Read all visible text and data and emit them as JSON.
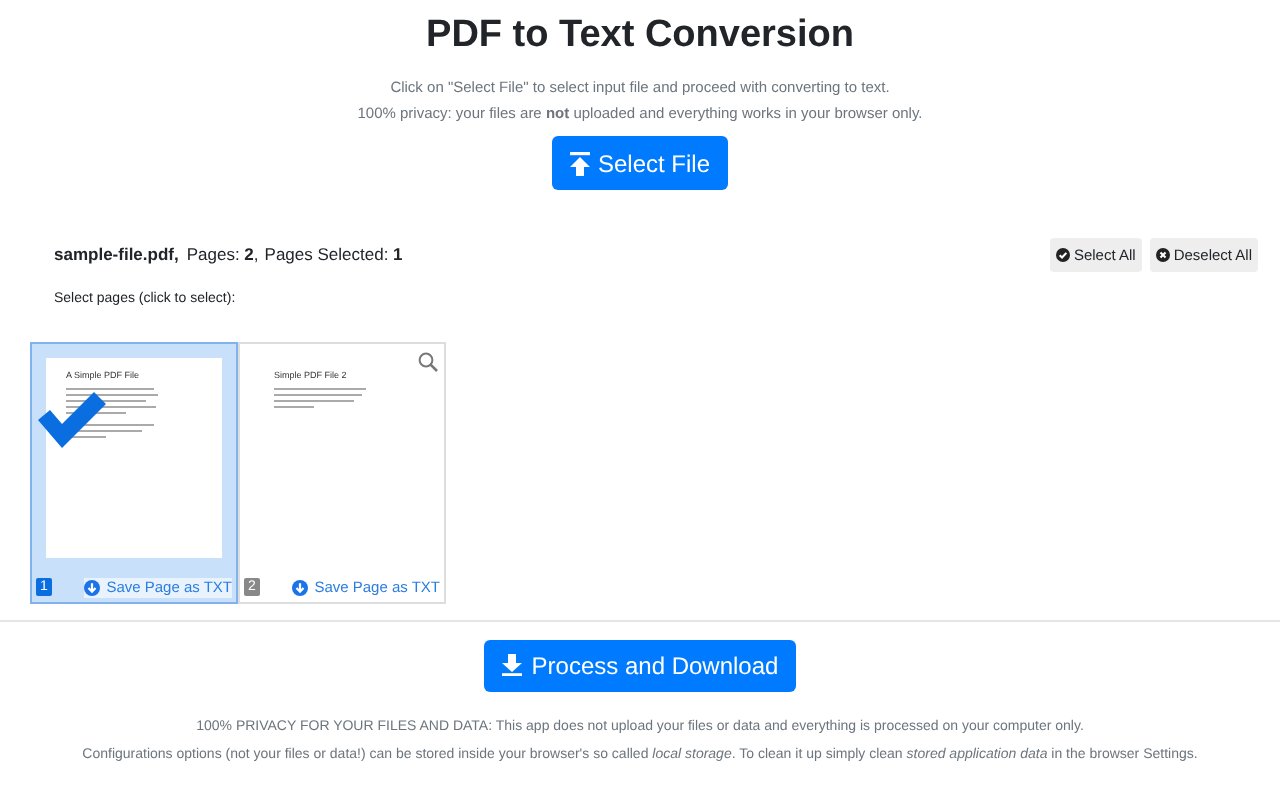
{
  "title": "PDF to Text Conversion",
  "intro": [
    "Click on \"Select File\" to select input file and proceed with converting to text.",
    "100% privacy: your files are **not** uploaded and everything works in your browser only."
  ],
  "select_button": "Select File",
  "file_info": {
    "name": "sample-file.pdf,",
    "pages": "Pages: **2**,",
    "selected": "Pages Selected: **1**"
  },
  "select_all": "Select All",
  "deselect_all": "Deselect All",
  "hint": "Select pages (click to select):",
  "pages": [
    {
      "number": "1",
      "heading": "A Simple PDF File",
      "save": "Save Page as TXT",
      "selected": true
    },
    {
      "number": "2",
      "heading": "Simple PDF File 2",
      "save": "Save Page as TXT",
      "selected": false
    }
  ],
  "process_button": "Process and Download",
  "footer": [
    "100% PRIVACY FOR YOUR FILES AND DATA: This app does not upload your files or data and everything is processed on your computer only.",
    "Configurations options (not your files or data!) can be stored inside your browser's so called *local storage*. To clean it up simply clean *stored application data* in the browser Settings."
  ]
}
